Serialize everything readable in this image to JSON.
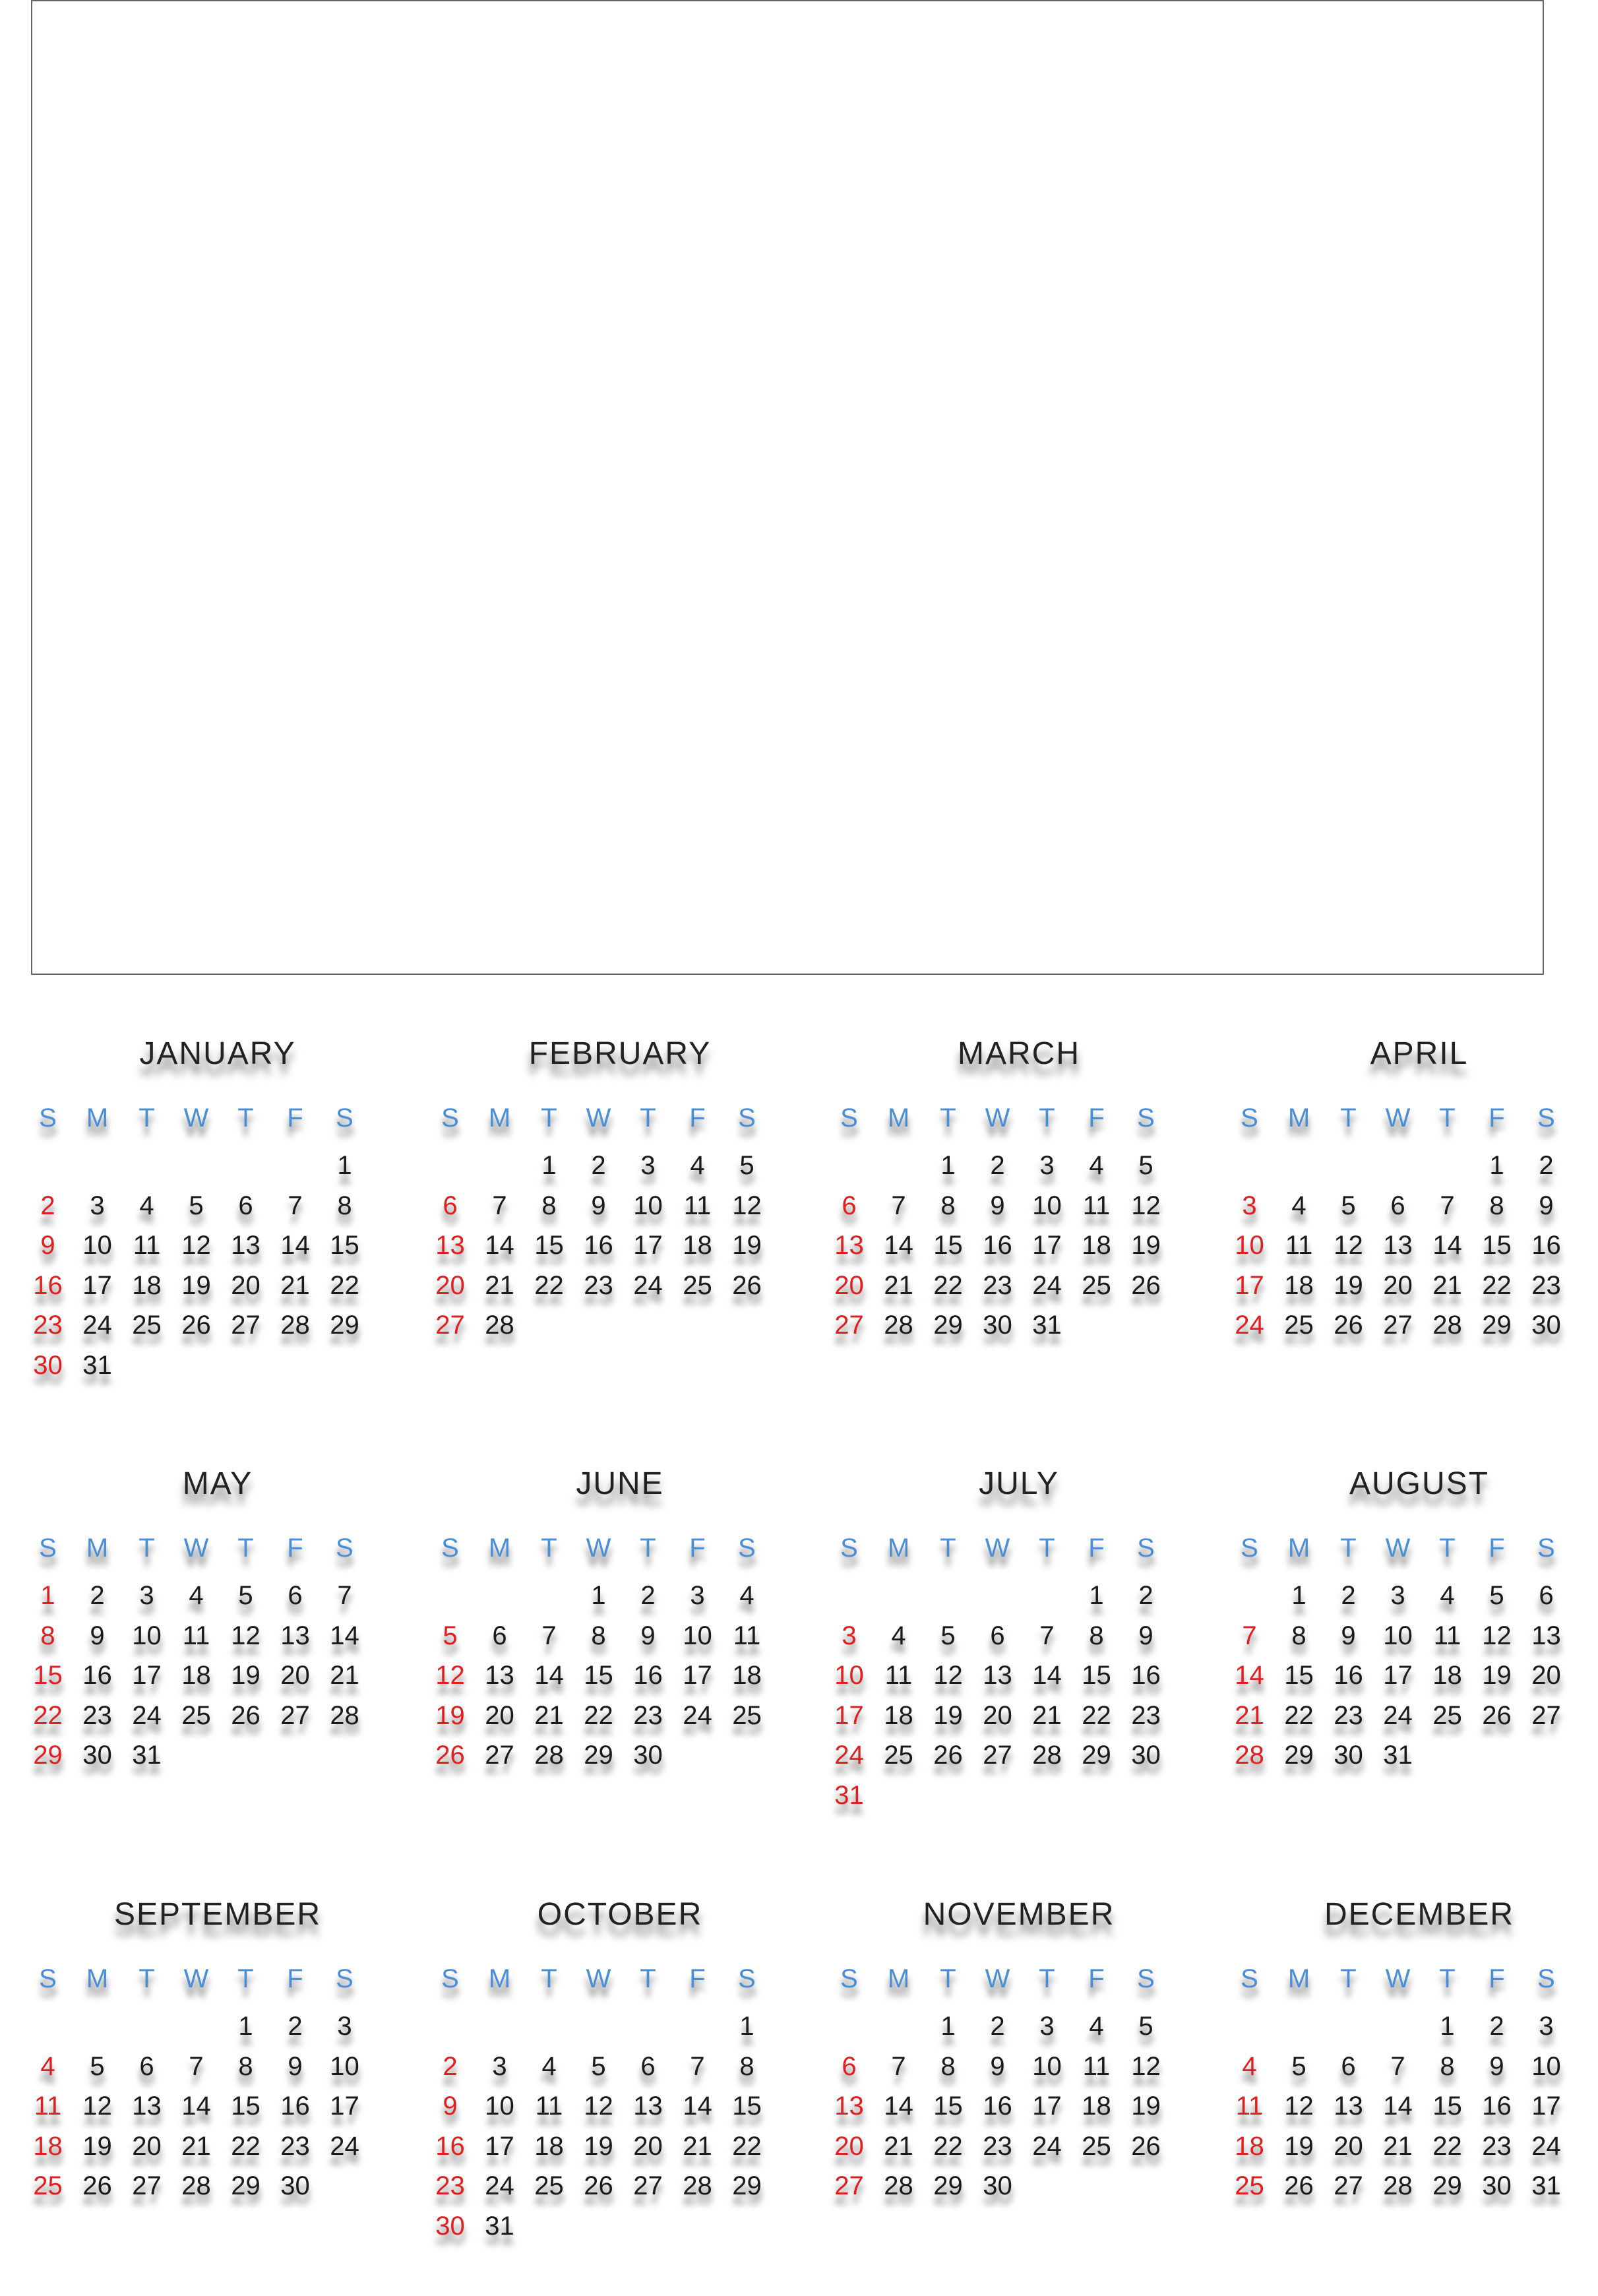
{
  "calendar": {
    "weekday_labels": [
      "S",
      "M",
      "T",
      "W",
      "T",
      "F",
      "S"
    ],
    "colors": {
      "weekday_header": "#4a8fd6",
      "sunday": "#e02020",
      "day": "#1a1a1a",
      "month_title": "#222222"
    },
    "months": [
      {
        "name": "JANUARY",
        "start": 6,
        "days": 31
      },
      {
        "name": "FEBRUARY",
        "start": 2,
        "days": 28
      },
      {
        "name": "MARCH",
        "start": 2,
        "days": 31
      },
      {
        "name": "APRIL",
        "start": 5,
        "days": 30
      },
      {
        "name": "MAY",
        "start": 0,
        "days": 31
      },
      {
        "name": "JUNE",
        "start": 3,
        "days": 30
      },
      {
        "name": "JULY",
        "start": 5,
        "days": 31
      },
      {
        "name": "AUGUST",
        "start": 1,
        "days": 31
      },
      {
        "name": "SEPTEMBER",
        "start": 4,
        "days": 30
      },
      {
        "name": "OCTOBER",
        "start": 6,
        "days": 31
      },
      {
        "name": "NOVEMBER",
        "start": 2,
        "days": 30
      },
      {
        "name": "DECEMBER",
        "start": 4,
        "days": 31
      }
    ]
  }
}
